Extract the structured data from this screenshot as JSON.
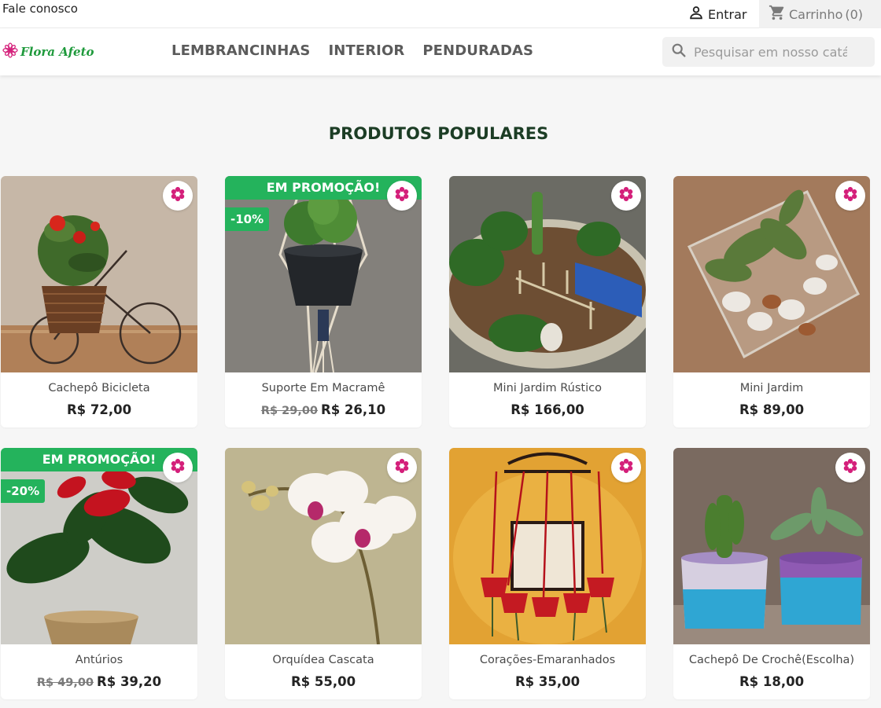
{
  "topbar": {
    "contact": "Fale conosco",
    "login": "Entrar",
    "cart_label": "Carrinho",
    "cart_count": "(0)"
  },
  "header": {
    "logo_text": "Flora Afeto",
    "nav": [
      "LEMBRANCINHAS",
      "INTERIOR",
      "PENDURADAS"
    ],
    "search_placeholder": "Pesquisar em nosso catálogo"
  },
  "section_title": "PRODUTOS POPULARES",
  "promo_label": "EM PROMOÇÃO!",
  "colors": {
    "accent_green": "#24b35c",
    "title_green": "#1c3d25",
    "wishlist_pink": "#d41f7a"
  },
  "products": [
    {
      "name": "Cachepô Bicicleta",
      "price": "R$ 72,00",
      "old_price": "",
      "discount": "",
      "promo": false
    },
    {
      "name": "Suporte Em Macramê",
      "price": "R$ 26,10",
      "old_price": "R$ 29,00",
      "discount": "-10%",
      "promo": true
    },
    {
      "name": "Mini Jardim Rústico",
      "price": "R$ 166,00",
      "old_price": "",
      "discount": "",
      "promo": false
    },
    {
      "name": "Mini Jardim",
      "price": "R$ 89,00",
      "old_price": "",
      "discount": "",
      "promo": false
    },
    {
      "name": "Antúrios",
      "price": "R$ 39,20",
      "old_price": "R$ 49,00",
      "discount": "-20%",
      "promo": true
    },
    {
      "name": "Orquídea Cascata",
      "price": "R$ 55,00",
      "old_price": "",
      "discount": "",
      "promo": false
    },
    {
      "name": "Corações-Emaranhados",
      "price": "R$ 35,00",
      "old_price": "",
      "discount": "",
      "promo": false
    },
    {
      "name": "Cachepô De Crochê(Escolha)",
      "price": "R$ 18,00",
      "old_price": "",
      "discount": "",
      "promo": false
    }
  ]
}
